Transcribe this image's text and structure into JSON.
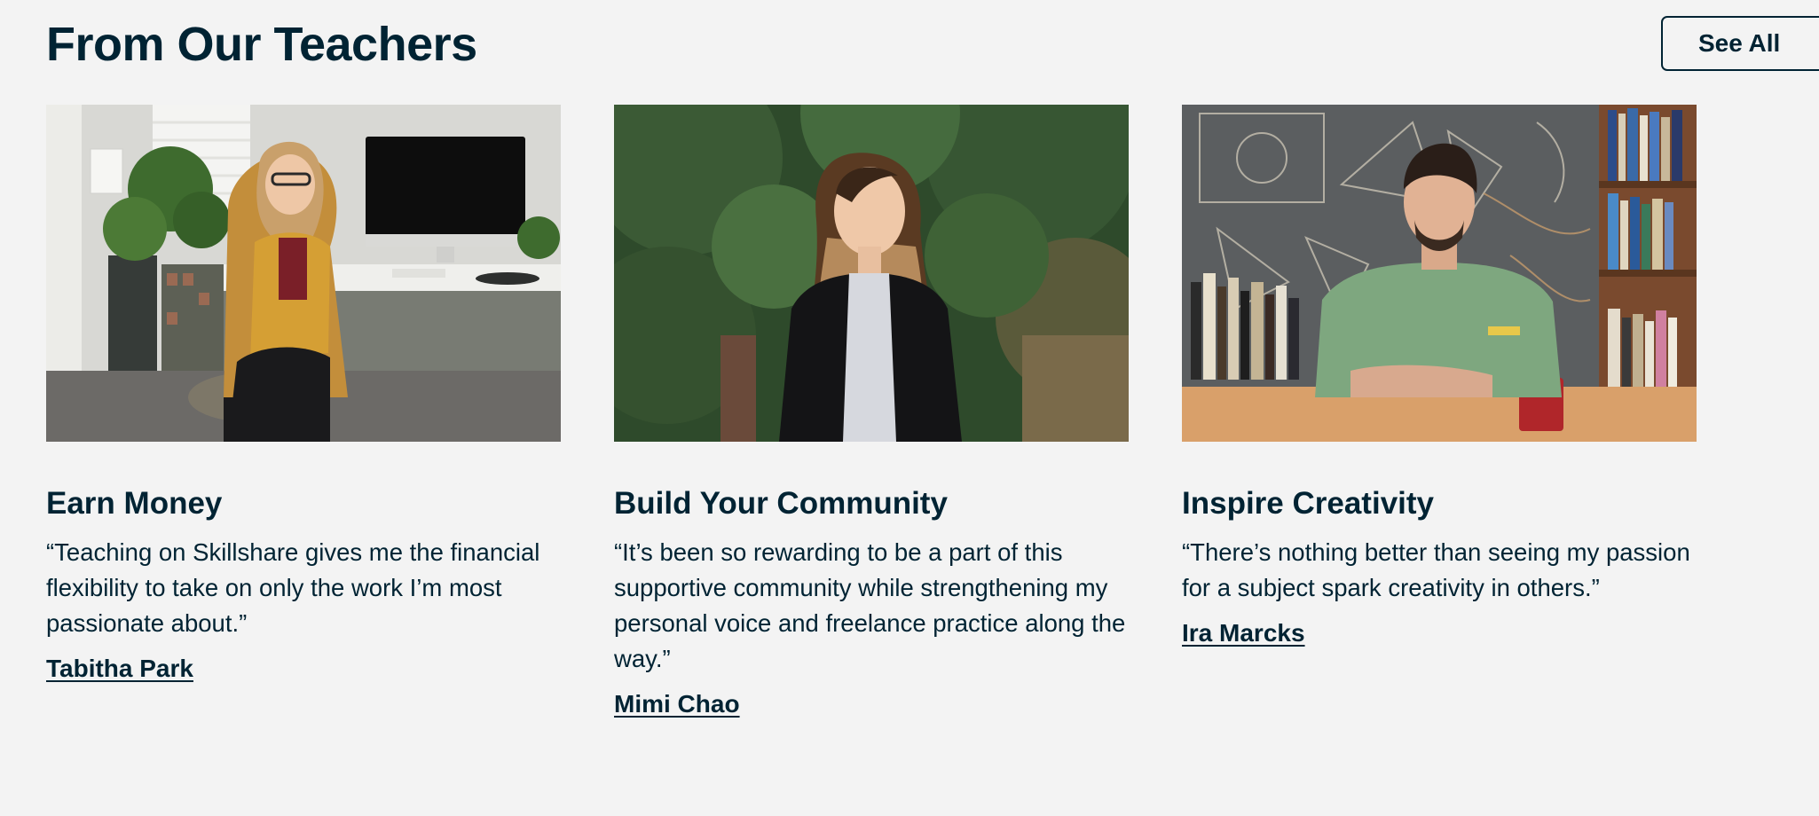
{
  "section": {
    "title": "From Our Teachers",
    "see_all_label": "See All"
  },
  "cards": [
    {
      "heading": "Earn Money",
      "quote": "“Teaching on Skillshare gives me the financial flexibility to take on only the work I’m most passionate about.”",
      "author": "Tabitha Park"
    },
    {
      "heading": "Build Your Community",
      "quote": "“It’s been so rewarding to be a part of this supportive community while strengthening my personal voice and freelance practice along the way.”",
      "author": "Mimi Chao"
    },
    {
      "heading": "Inspire Creativity",
      "quote": "“There’s nothing better than seeing my passion for a subject spark creativity in others.”",
      "author": "Ira Marcks"
    }
  ],
  "colors": {
    "background": "#f3f3f3",
    "text": "#002333"
  }
}
